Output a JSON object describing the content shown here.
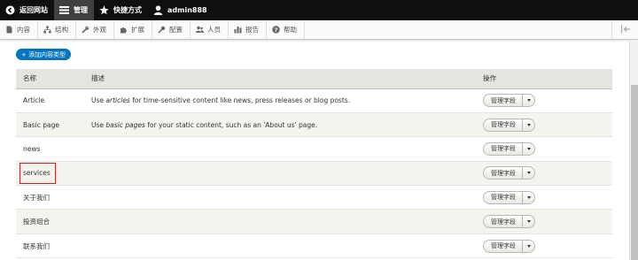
{
  "toolbar": {
    "back_label": "返回网站",
    "manage_label": "管理",
    "shortcuts_label": "快捷方式",
    "user_label": "admin888"
  },
  "tray": {
    "items": [
      {
        "label": "内容",
        "icon": "file-icon"
      },
      {
        "label": "结构",
        "icon": "sitemap-icon"
      },
      {
        "label": "外观",
        "icon": "wrench-icon"
      },
      {
        "label": "扩展",
        "icon": "puzzle-icon"
      },
      {
        "label": "配置",
        "icon": "gear-icon"
      },
      {
        "label": "人员",
        "icon": "people-icon"
      },
      {
        "label": "报告",
        "icon": "bar-chart-icon"
      },
      {
        "label": "帮助",
        "icon": "help-icon"
      }
    ]
  },
  "add_button": "+ 添加内容类型",
  "table": {
    "headers": {
      "name": "名称",
      "description": "描述",
      "operations": "操作"
    },
    "operation_label": "管理字段",
    "rows": [
      {
        "name": "Article",
        "desc_before": "Use ",
        "desc_em": "articles",
        "desc_after": " for time-sensitive content like news, press releases or blog posts."
      },
      {
        "name": "Basic page",
        "desc_before": "Use ",
        "desc_em": "basic pages",
        "desc_after": " for your static content, such as an 'About us' page."
      },
      {
        "name": "news",
        "desc_before": "",
        "desc_em": "",
        "desc_after": ""
      },
      {
        "name": "services",
        "desc_before": "",
        "desc_em": "",
        "desc_after": ""
      },
      {
        "name": "关于我们",
        "desc_before": "",
        "desc_em": "",
        "desc_after": ""
      },
      {
        "name": "投资组合",
        "desc_before": "",
        "desc_em": "",
        "desc_after": ""
      },
      {
        "name": "联系我们",
        "desc_before": "",
        "desc_em": "",
        "desc_after": ""
      }
    ]
  },
  "colors": {
    "toolbar_bg": "#0f0f0f",
    "primary_button": "#0074bd",
    "highlight_box": "#d42020",
    "header_bg": "#e6e4df"
  }
}
